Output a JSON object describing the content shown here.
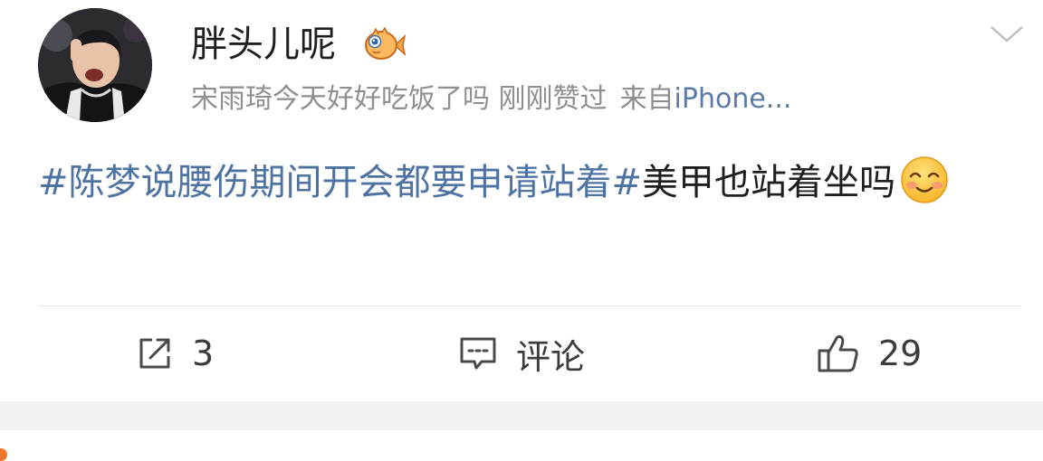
{
  "post": {
    "author": {
      "name": "胖头儿呢",
      "badge_icon": "fish-badge-icon"
    },
    "meta": {
      "liked_text": "宋雨琦今天好好吃饭了吗 刚刚赞过",
      "source_prefix": "来自",
      "source": "iPhone..."
    },
    "content": {
      "topic": "#陈梦说腰伤期间开会都要申请站着#",
      "text": "美甲也站着坐吗",
      "emoji": "smile-emoji"
    },
    "actions": {
      "repost_count": "3",
      "comment_label": "评论",
      "like_count": "29"
    },
    "menu_icon": "chevron-down-icon"
  },
  "colors": {
    "topic_link": "#4e73a3",
    "meta_text": "#8e8e93",
    "text": "#1f1f1f",
    "divider": "#e6e6e6",
    "band": "#f2f2f2"
  }
}
